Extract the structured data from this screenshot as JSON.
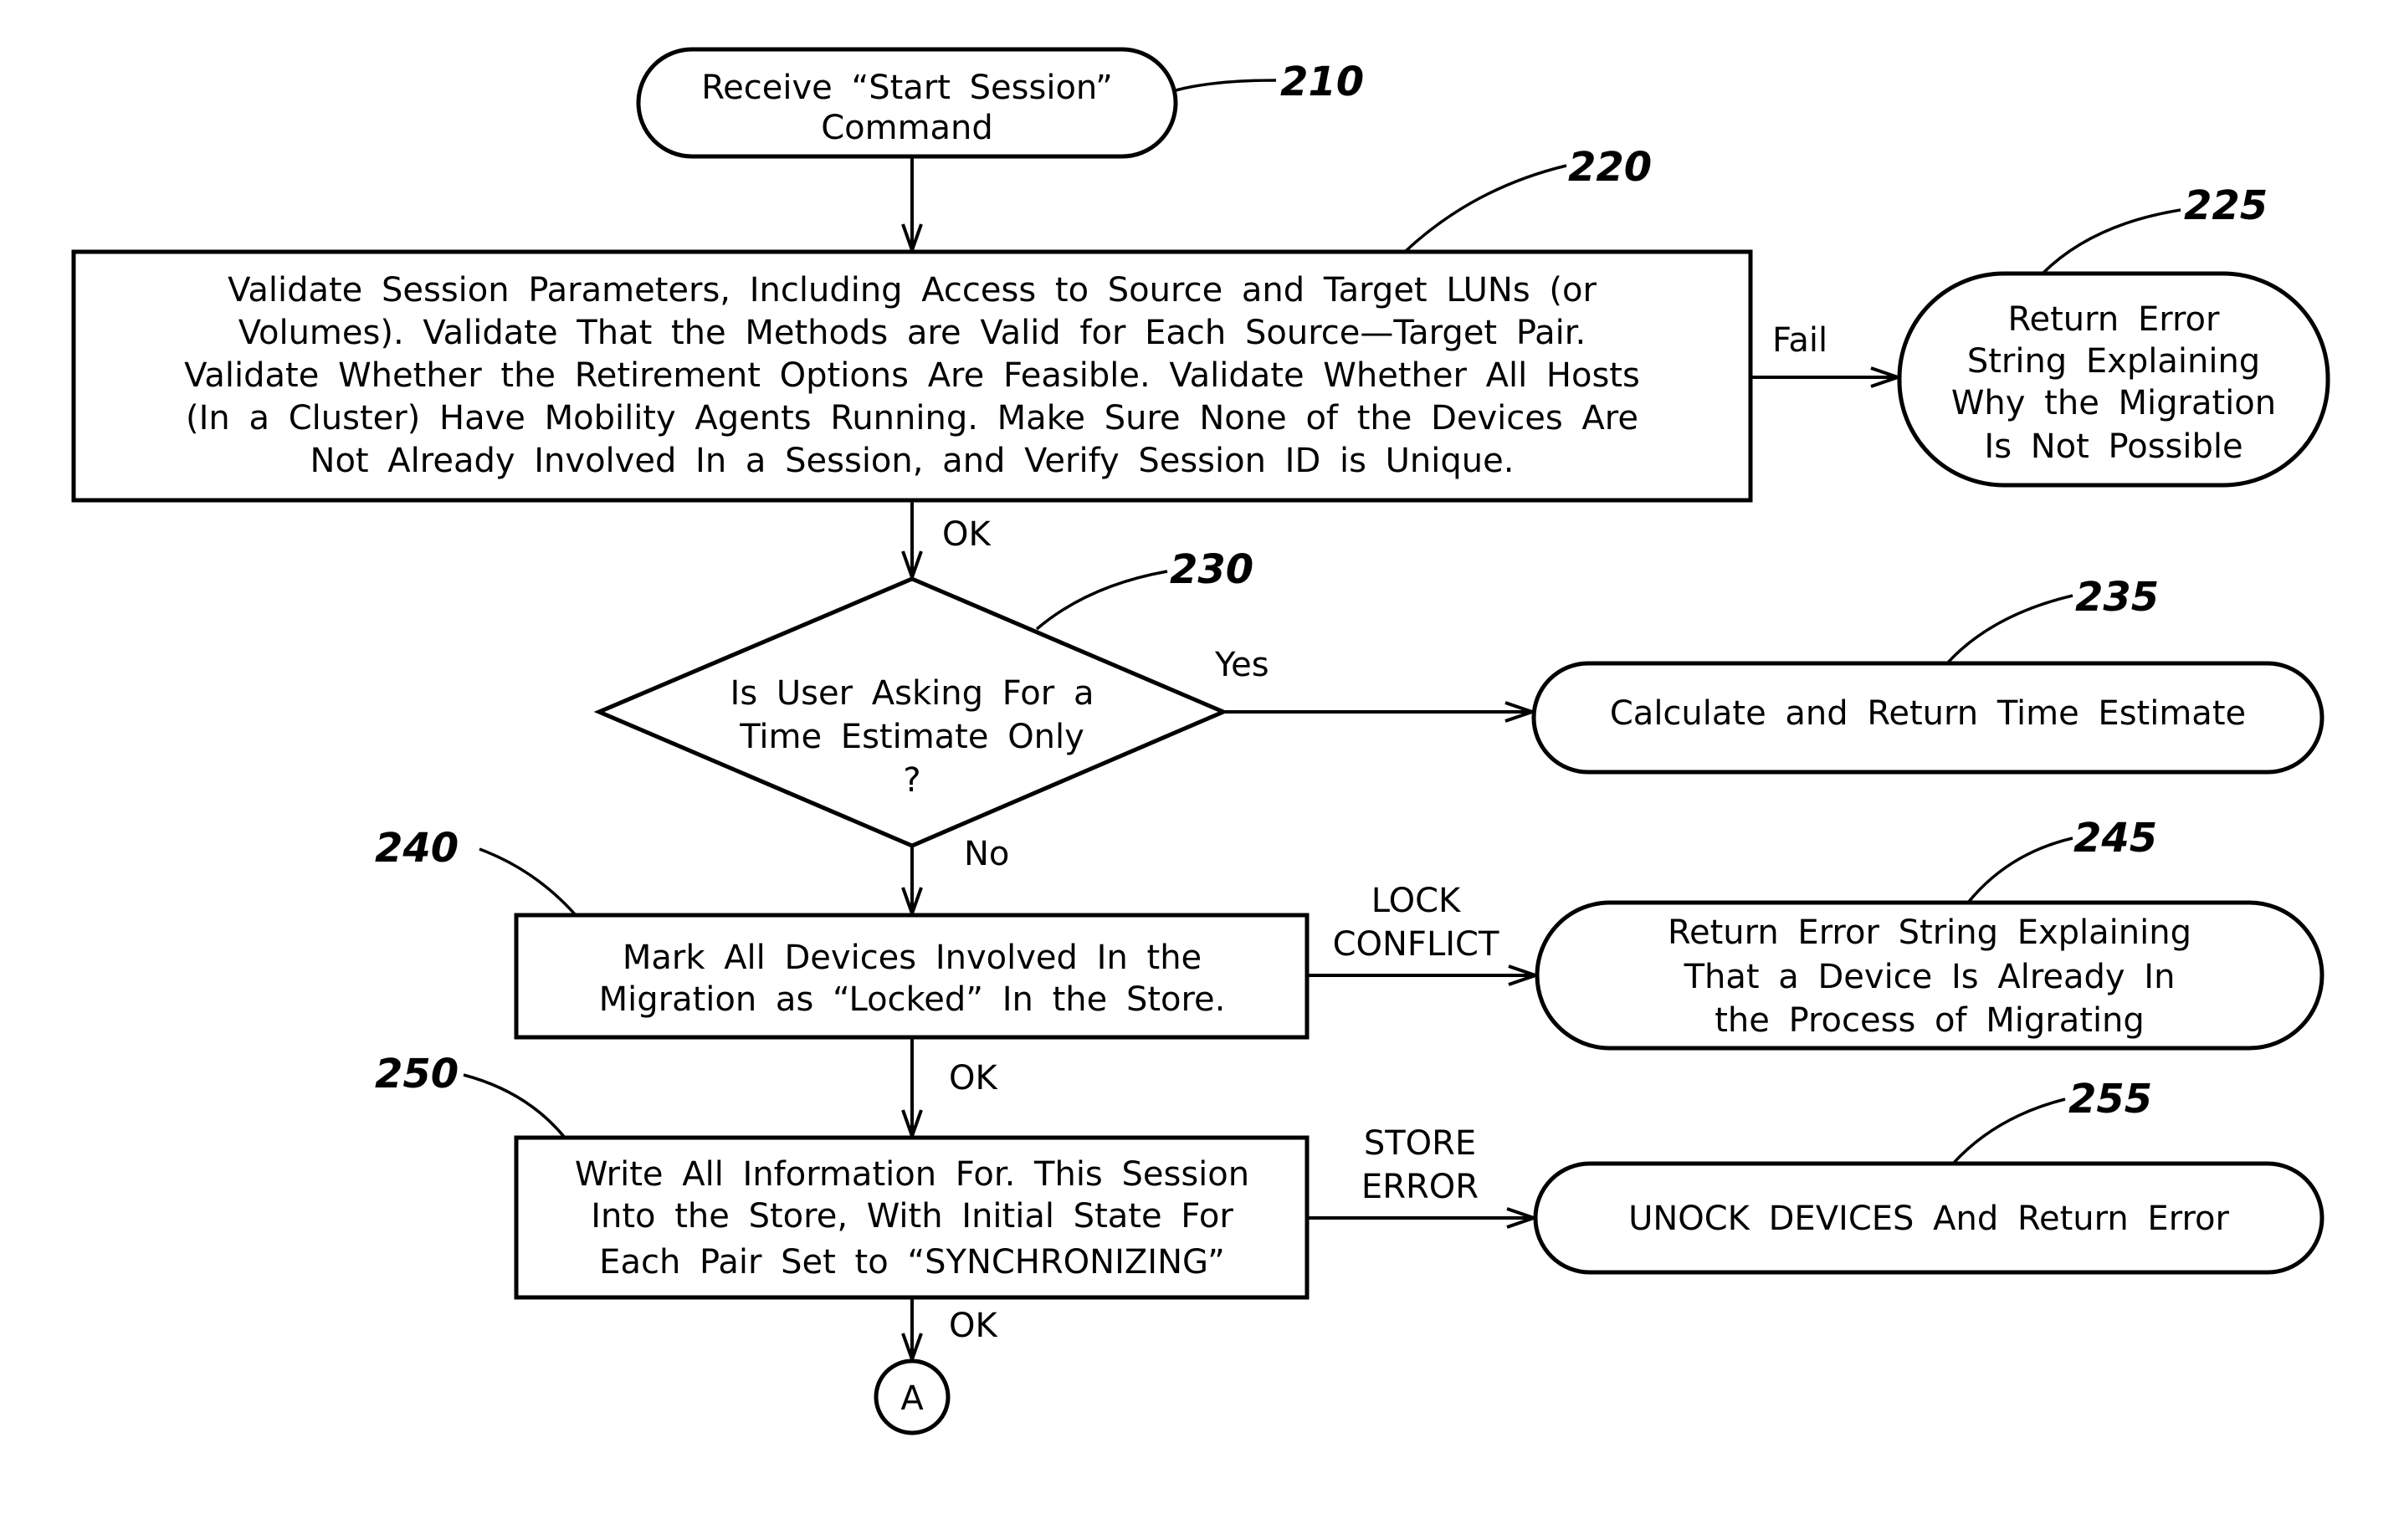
{
  "figure": {
    "nodes": {
      "n210": {
        "ref": "210",
        "shape": "terminator",
        "lines": [
          "Receive “Start Session”",
          "Command"
        ]
      },
      "n220": {
        "ref": "220",
        "shape": "process",
        "lines": [
          "Validate Session Parameters, Including Access to Source and Target LUNs (or",
          "Volumes). Validate That the Methods are Valid for Each Source—Target Pair.",
          "Validate Whether the Retirement Options Are Feasible. Validate Whether All Hosts",
          "(In a Cluster) Have Mobility Agents Running. Make Sure None of the Devices Are",
          "Not Already Involved In a Session, and Verify Session ID is Unique."
        ]
      },
      "n225": {
        "ref": "225",
        "shape": "terminator",
        "lines": [
          "Return Error",
          "String Explaining",
          "Why the Migration",
          "Is Not Possible"
        ]
      },
      "n230": {
        "ref": "230",
        "shape": "decision",
        "lines": [
          "Is User Asking For a",
          "Time Estimate Only",
          "?"
        ]
      },
      "n235": {
        "ref": "235",
        "shape": "terminator",
        "lines": [
          "Calculate and Return Time Estimate"
        ]
      },
      "n240": {
        "ref": "240",
        "shape": "process",
        "lines": [
          "Mark All Devices Involved In the",
          "Migration as “Locked” In the Store."
        ]
      },
      "n245": {
        "ref": "245",
        "shape": "terminator",
        "lines": [
          "Return Error String Explaining",
          "That a Device Is Already In",
          "the Process of Migrating"
        ]
      },
      "n250": {
        "ref": "250",
        "shape": "process",
        "lines": [
          "Write All Information For. This Session",
          "Into the Store, With Initial State For",
          "Each Pair Set to “SYNCHRONIZING”"
        ]
      },
      "n255": {
        "ref": "255",
        "shape": "terminator",
        "lines": [
          "UNOCK DEVICES And Return Error"
        ]
      },
      "connectorA": {
        "shape": "connector",
        "label": "A"
      }
    },
    "edges": {
      "e210_220": {
        "from": "210",
        "to": "220",
        "label": ""
      },
      "e220_225": {
        "from": "220",
        "to": "225",
        "label": "Fail"
      },
      "e220_230": {
        "from": "220",
        "to": "230",
        "label": "OK"
      },
      "e230_235": {
        "from": "230",
        "to": "235",
        "label": "Yes"
      },
      "e230_240": {
        "from": "230",
        "to": "240",
        "label": "No"
      },
      "e240_245": {
        "from": "240",
        "to": "245",
        "label_lines": [
          "LOCK",
          "CONFLICT"
        ]
      },
      "e240_250": {
        "from": "240",
        "to": "250",
        "label": "OK"
      },
      "e250_255": {
        "from": "250",
        "to": "255",
        "label_lines": [
          "STORE",
          "ERROR"
        ]
      },
      "e250_A": {
        "from": "250",
        "to": "A",
        "label": "OK"
      }
    }
  }
}
